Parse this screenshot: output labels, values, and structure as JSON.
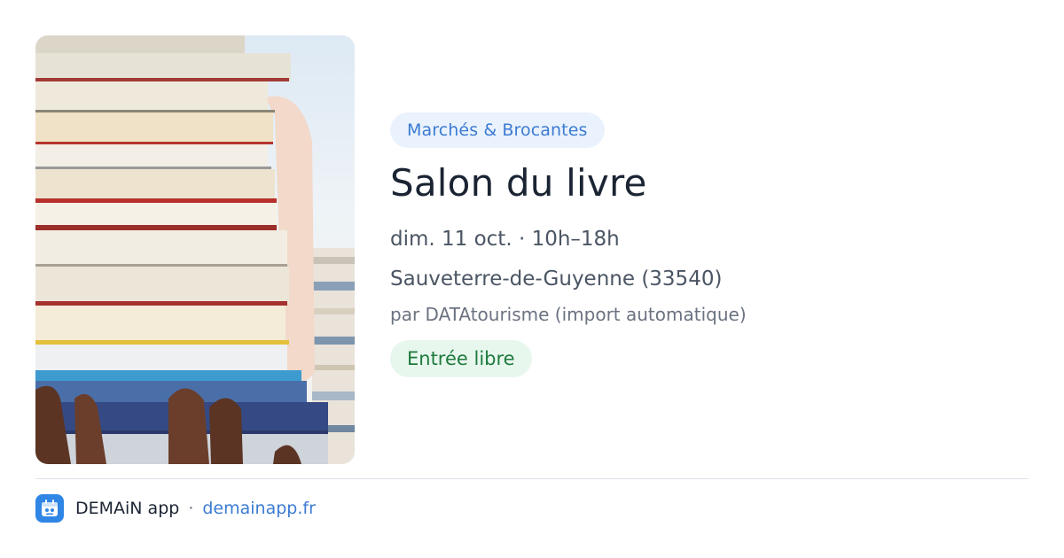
{
  "event": {
    "category": "Marchés & Brocantes",
    "title": "Salon du livre",
    "when": "dim. 11 oct. · 10h–18h",
    "where": "Sauveterre-de-Guyenne (33540)",
    "source": "par DATAtourisme (import automatique)",
    "price": "Entrée libre",
    "image_icon": "stack-of-books-photo"
  },
  "footer": {
    "app_name": "DEMAiN app",
    "separator": "·",
    "link": "demainapp.fr",
    "logo_icon": "demain-app-logo-icon"
  },
  "colors": {
    "accent": "#3b7bd2",
    "category_bg": "#eaf2fd",
    "price_text": "#1f7a3d",
    "price_bg": "#e8f7ee",
    "title": "#1b2433"
  }
}
